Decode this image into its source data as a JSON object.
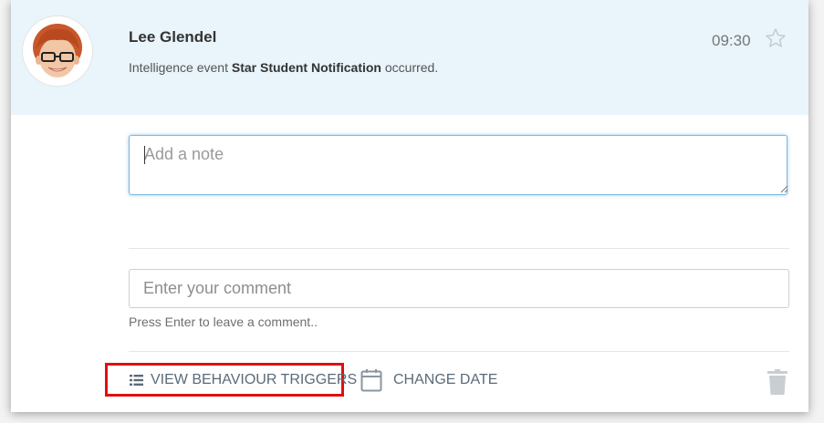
{
  "post": {
    "author": "Lee Glendel",
    "event_prefix": "Intelligence event ",
    "event_name": "Star Student Notification",
    "event_suffix": " occurred.",
    "time": "09:30"
  },
  "note": {
    "placeholder": "Add a note"
  },
  "comment": {
    "placeholder": "Enter your comment",
    "hint": "Press Enter to leave a comment.."
  },
  "actions": {
    "view_triggers": "VIEW BEHAVIOUR TRIGGERS",
    "change_date": "CHANGE DATE"
  },
  "icons": {
    "avatar": "student-avatar",
    "star": "star-icon",
    "list": "list-icon",
    "calendar": "calendar-icon",
    "trash": "trash-icon"
  },
  "colors": {
    "header_bg": "#e9f4fb",
    "highlight_border": "#e01010",
    "action_text": "#5b6a78"
  }
}
